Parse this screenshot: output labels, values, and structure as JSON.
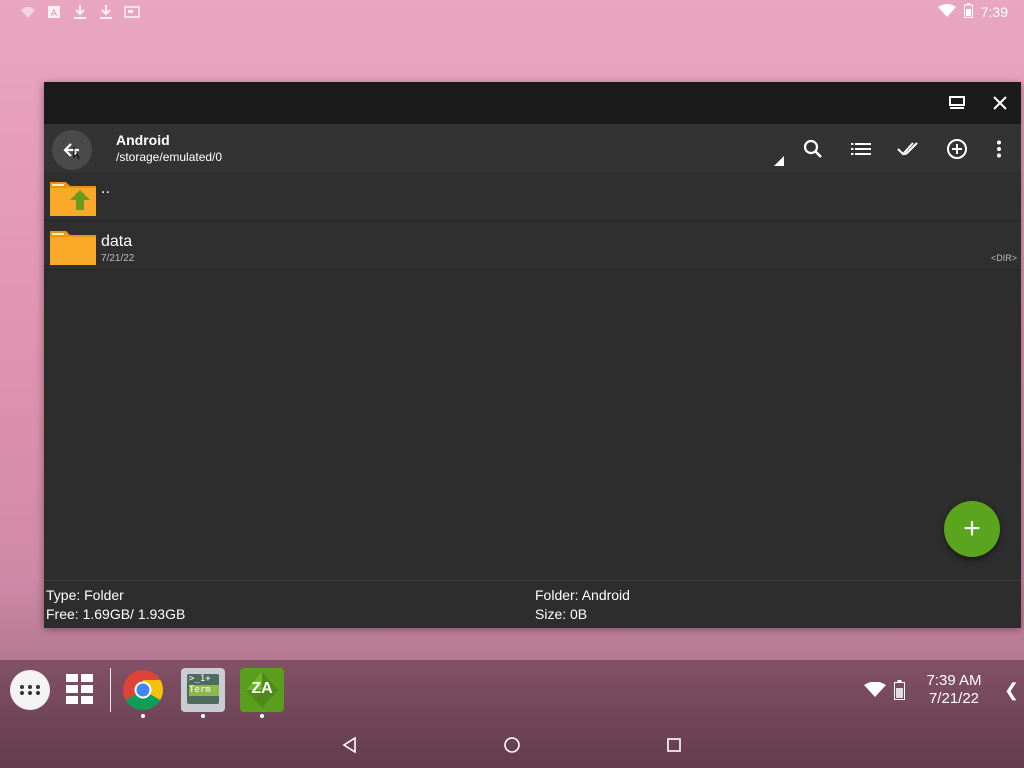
{
  "status_bar": {
    "time": "7:39",
    "left_icons": [
      "notification-icon",
      "text-icon",
      "download-icon",
      "download-icon",
      "screenshot-icon"
    ],
    "right_icons": [
      "wifi-icon",
      "battery-icon"
    ]
  },
  "window": {
    "title_buttons": [
      "maximize-icon",
      "close-icon"
    ],
    "path_title": "Android",
    "path_subtitle": "/storage/emulated/0",
    "toolbar_icons": [
      "search-icon",
      "list-view-icon",
      "select-all-icon",
      "add-circle-icon",
      "more-vert-icon"
    ],
    "files": [
      {
        "name": "..",
        "type": "parent",
        "date": "",
        "tag": ""
      },
      {
        "name": "data",
        "type": "folder",
        "date": "7/21/22",
        "tag": "<DIR>"
      }
    ],
    "fab_label": "+",
    "info": {
      "type": "Type: Folder",
      "free": "Free: 1.69GB/ 1.93GB",
      "folder": "Folder: Android",
      "size": "Size: 0B"
    }
  },
  "taskbar": {
    "apps": [
      {
        "name": "Chrome"
      },
      {
        "name": "Terminal",
        "label_top": ">_1+",
        "label_bottom": "Term"
      },
      {
        "name": "ZArchiver",
        "label": "ZA"
      }
    ],
    "tray_time": "7:39 AM",
    "tray_date": "7/21/22",
    "expand_label": "❮"
  },
  "colors": {
    "accent_green": "#5aa51d",
    "folder_orange": "#f6a623",
    "window_bg": "#2d2d2d"
  }
}
